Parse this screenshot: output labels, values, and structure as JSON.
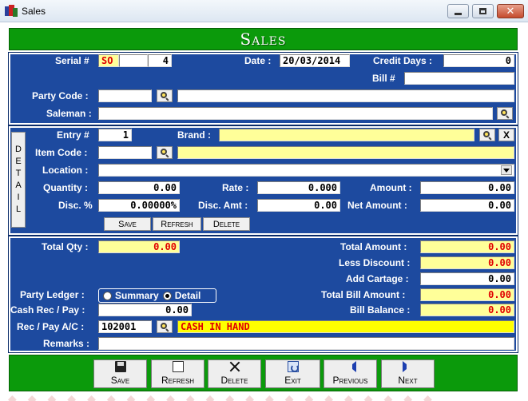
{
  "window": {
    "title": "Sales"
  },
  "header": {
    "title": "Sales"
  },
  "top": {
    "serial_label": "Serial #",
    "serial_prefix": "SO",
    "serial_mid": "",
    "serial_number": "4",
    "date_label": "Date :",
    "date_value": "20/03/2014",
    "credit_days_label": "Credit Days :",
    "credit_days_value": "0",
    "bill_label": "Bill #",
    "bill_value": "",
    "party_code_label": "Party Code :",
    "party_code_value": "",
    "party_name_value": "",
    "saleman_label": "Saleman :",
    "saleman_value": ""
  },
  "detail": {
    "tab_letters": [
      "D",
      "E",
      "T",
      "A",
      "I",
      "L"
    ],
    "entry_label": "Entry #",
    "entry_value": "1",
    "brand_label": "Brand :",
    "brand_value": "",
    "clear_label": "X",
    "item_code_label": "Item Code :",
    "item_code_value": "",
    "item_name_value": "",
    "location_label": "Location :",
    "location_value": "",
    "quantity_label": "Quantity :",
    "quantity_value": "0.00",
    "rate_label": "Rate :",
    "rate_value": "0.000",
    "amount_label": "Amount :",
    "amount_value": "0.00",
    "disc_pct_label": "Disc. %",
    "disc_pct_value": "0.00000%",
    "disc_amt_label": "Disc. Amt :",
    "disc_amt_value": "0.00",
    "net_amount_label": "Net Amount :",
    "net_amount_value": "0.00",
    "save_label": "Save",
    "refresh_label": "Refresh",
    "delete_label": "Delete"
  },
  "summary": {
    "total_qty_label": "Total Qty :",
    "total_qty_value": "0.00",
    "total_amount_label": "Total Amount :",
    "total_amount_value": "0.00",
    "less_discount_label": "Less Discount :",
    "less_discount_value": "0.00",
    "add_cartage_label": "Add Cartage :",
    "add_cartage_value": "0.00",
    "party_ledger_label": "Party Ledger :",
    "summary_option": "Summary",
    "detail_option": "Detail",
    "total_bill_label": "Total Bill Amount :",
    "total_bill_value": "0.00",
    "cash_rec_label": "Cash Rec / Pay :",
    "cash_rec_value": "0.00",
    "bill_balance_label": "Bill Balance :",
    "bill_balance_value": "0.00",
    "rec_pay_ac_label": "Rec / Pay A/C :",
    "rec_pay_ac_code": "102001",
    "rec_pay_ac_name": "CASH IN HAND",
    "remarks_label": "Remarks :",
    "remarks_value": ""
  },
  "footer": {
    "save": "Save",
    "refresh": "Refresh",
    "delete": "Delete",
    "exit": "Exit",
    "previous": "Previous",
    "next": "Next"
  },
  "colors": {
    "panel_blue": "#1d4a9f",
    "header_green": "#0b9a0b",
    "highlight_yellow": "#ffff99",
    "value_red": "#e00000"
  }
}
